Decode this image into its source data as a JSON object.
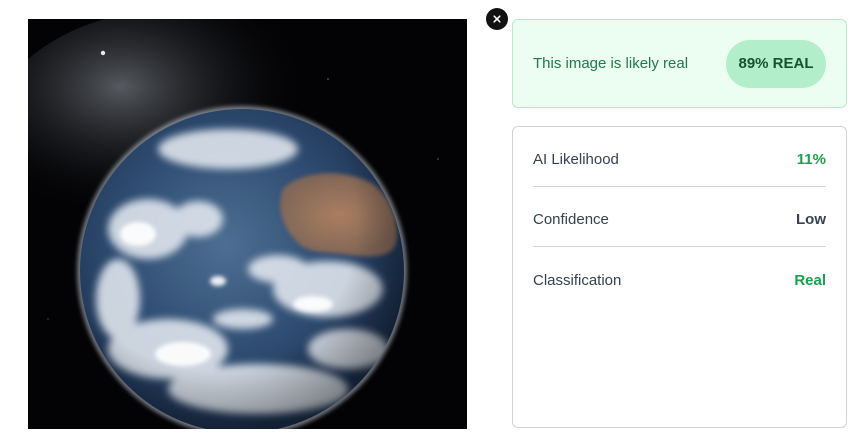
{
  "image": {
    "subject": "earth-from-space-photo"
  },
  "close_button": {
    "icon": "close-icon"
  },
  "verdict": {
    "text": "This image is likely real",
    "badge": "89% REAL",
    "colors": {
      "background": "#ecfdf2",
      "text": "#1f7a46",
      "badge_bg": "#b3eecb",
      "badge_text": "#14532d"
    }
  },
  "metrics": [
    {
      "label": "AI Likelihood",
      "value": "11%",
      "color": "#16a34a"
    },
    {
      "label": "Confidence",
      "value": "Low",
      "color": "#374151"
    },
    {
      "label": "Classification",
      "value": "Real",
      "color": "#16a34a"
    }
  ]
}
